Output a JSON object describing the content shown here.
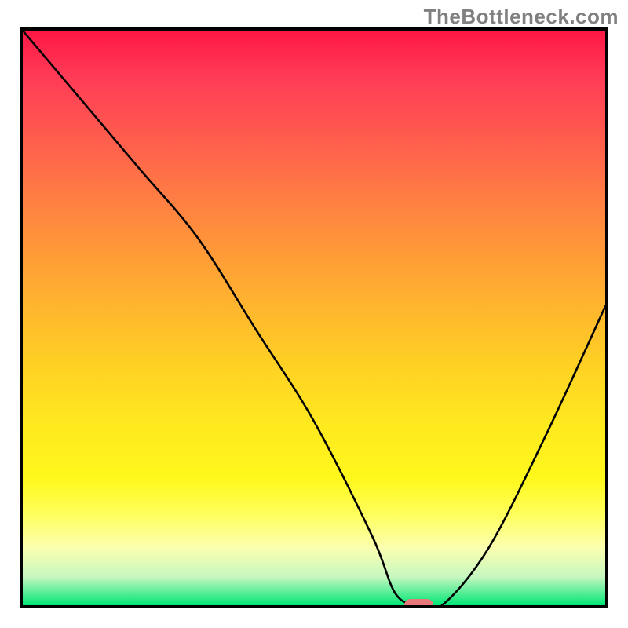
{
  "watermark": "TheBottleneck.com",
  "chart_data": {
    "type": "line",
    "title": "",
    "xlabel": "",
    "ylabel": "",
    "xlim": [
      0,
      100
    ],
    "ylim": [
      0,
      100
    ],
    "grid": false,
    "legend": false,
    "background": "rainbow-gradient-red-to-green",
    "series": [
      {
        "name": "bottleneck-curve",
        "x": [
          0,
          10,
          20,
          30,
          40,
          50,
          60,
          64,
          68,
          72,
          80,
          90,
          100
        ],
        "y": [
          100,
          88,
          76,
          64,
          48,
          32,
          12,
          2,
          0,
          0,
          10,
          30,
          52
        ]
      }
    ],
    "marker": {
      "name": "optimal-point",
      "x": 68,
      "y": 0,
      "width_pct": 5,
      "height_pct": 2.2,
      "color": "#e8787a"
    }
  }
}
